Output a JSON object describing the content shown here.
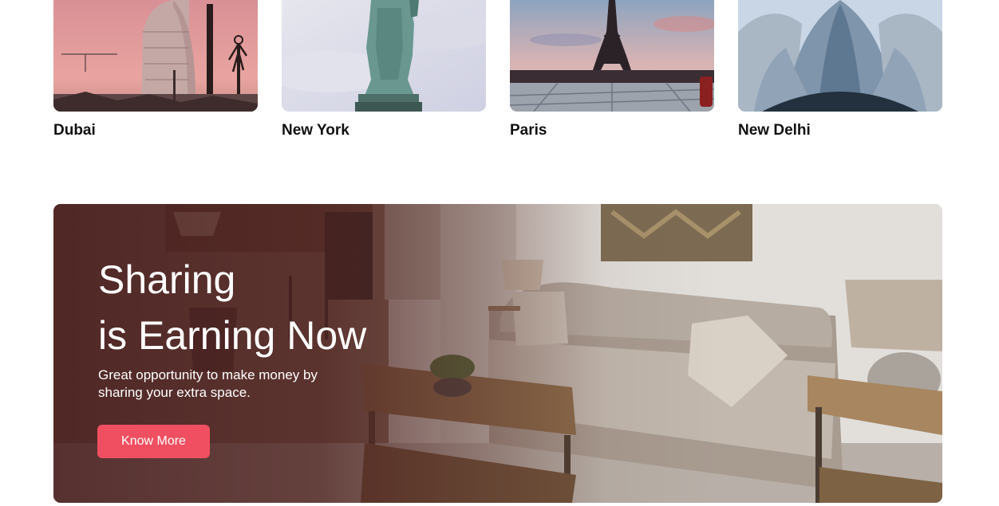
{
  "destinations": [
    {
      "name": "Dubai",
      "icon": "burj-al-arab-photo"
    },
    {
      "name": "New York",
      "icon": "statue-of-liberty-photo"
    },
    {
      "name": "Paris",
      "icon": "eiffel-tower-photo"
    },
    {
      "name": "New Delhi",
      "icon": "lotus-temple-photo"
    }
  ],
  "banner": {
    "title_line1": "Sharing",
    "title_line2": "is Earning Now",
    "subtitle": "Great opportunity to make money by sharing your extra space.",
    "button_label": "Know More",
    "background": "living-room-photo"
  },
  "colors": {
    "accent": "#f04f61",
    "text_dark": "#111111",
    "banner_overlay": "#4a1e1e"
  }
}
